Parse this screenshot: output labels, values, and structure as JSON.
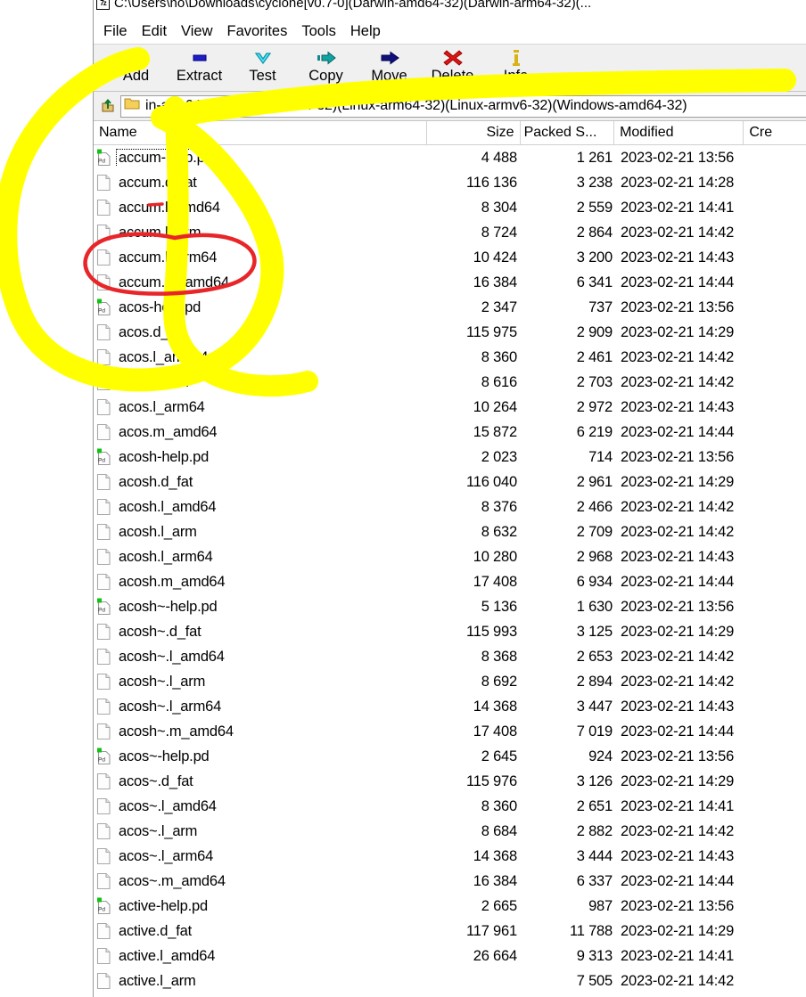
{
  "window": {
    "title": "C:\\Users\\ho\\Downloads\\cyclone[v0.7-0](Darwin-amd64-32)(Darwin-arm64-32)(...",
    "app_glyph": "7z"
  },
  "menubar": {
    "items": [
      {
        "label": "File"
      },
      {
        "label": "Edit"
      },
      {
        "label": "View"
      },
      {
        "label": "Favorites"
      },
      {
        "label": "Tools"
      },
      {
        "label": "Help"
      }
    ]
  },
  "toolbar": {
    "buttons": [
      {
        "label": "Add",
        "icon": "plus-icon",
        "color": "#00d000"
      },
      {
        "label": "Extract",
        "icon": "minus-bar-icon",
        "color": "#0000c0"
      },
      {
        "label": "Test",
        "icon": "chevron-down-icon",
        "color": "#00c8d8"
      },
      {
        "label": "Copy",
        "icon": "arrow-right-teal-icon",
        "color": "#008c8c"
      },
      {
        "label": "Move",
        "icon": "arrow-right-navy-icon",
        "color": "#000080"
      },
      {
        "label": "Delete",
        "icon": "cross-icon",
        "color": "#e00000"
      },
      {
        "label": "Info",
        "icon": "info-icon",
        "color": "#c8a000"
      }
    ]
  },
  "addressbar": {
    "up_icon": "up-folder-icon",
    "folder_icon": "folder-icon",
    "path": "in-arm64-32)(Linux-amd64-32)(Linux-arm64-32)(Linux-armv6-32)(Windows-amd64-32)"
  },
  "columns": [
    {
      "key": "name",
      "label": "Name"
    },
    {
      "key": "size",
      "label": "Size"
    },
    {
      "key": "packed",
      "label": "Packed S..."
    },
    {
      "key": "mod",
      "label": "Modified"
    },
    {
      "key": "crea",
      "label": "Cre"
    }
  ],
  "annotations": {
    "highlighter_color": "#ffff00",
    "circle_color": "#e8262a",
    "underline_color": "#e8262a",
    "circled_rows": [
      "accum.l_arm",
      "accum.l_arm64"
    ]
  },
  "files": [
    {
      "name": "accum-help.pd",
      "icon": "pd-doc-icon",
      "size": "4 488",
      "packed": "1 261",
      "modified": "2023-02-21 13:56",
      "focused": true
    },
    {
      "name": "accum.d_fat",
      "icon": "blank-doc-icon",
      "size": "116 136",
      "packed": "3 238",
      "modified": "2023-02-21 14:28"
    },
    {
      "name": "accum.l_amd64",
      "icon": "blank-doc-icon",
      "size": "8 304",
      "packed": "2 559",
      "modified": "2023-02-21 14:41"
    },
    {
      "name": "accum.l_arm",
      "icon": "blank-doc-icon",
      "size": "8 724",
      "packed": "2 864",
      "modified": "2023-02-21 14:42"
    },
    {
      "name": "accum.l_arm64",
      "icon": "blank-doc-icon",
      "size": "10 424",
      "packed": "3 200",
      "modified": "2023-02-21 14:43"
    },
    {
      "name": "accum.m_amd64",
      "icon": "blank-doc-icon",
      "size": "16 384",
      "packed": "6 341",
      "modified": "2023-02-21 14:44"
    },
    {
      "name": "acos-help.pd",
      "icon": "pd-doc-icon",
      "size": "2 347",
      "packed": "737",
      "modified": "2023-02-21 13:56"
    },
    {
      "name": "acos.d_fat",
      "icon": "blank-doc-icon",
      "size": "115 975",
      "packed": "2 909",
      "modified": "2023-02-21 14:29"
    },
    {
      "name": "acos.l_amd64",
      "icon": "blank-doc-icon",
      "size": "8 360",
      "packed": "2 461",
      "modified": "2023-02-21 14:42"
    },
    {
      "name": "acos.l_arm",
      "icon": "blank-doc-icon",
      "size": "8 616",
      "packed": "2 703",
      "modified": "2023-02-21 14:42"
    },
    {
      "name": "acos.l_arm64",
      "icon": "blank-doc-icon",
      "size": "10 264",
      "packed": "2 972",
      "modified": "2023-02-21 14:43"
    },
    {
      "name": "acos.m_amd64",
      "icon": "blank-doc-icon",
      "size": "15 872",
      "packed": "6 219",
      "modified": "2023-02-21 14:44"
    },
    {
      "name": "acosh-help.pd",
      "icon": "pd-doc-icon",
      "size": "2 023",
      "packed": "714",
      "modified": "2023-02-21 13:56"
    },
    {
      "name": "acosh.d_fat",
      "icon": "blank-doc-icon",
      "size": "116 040",
      "packed": "2 961",
      "modified": "2023-02-21 14:29"
    },
    {
      "name": "acosh.l_amd64",
      "icon": "blank-doc-icon",
      "size": "8 376",
      "packed": "2 466",
      "modified": "2023-02-21 14:42"
    },
    {
      "name": "acosh.l_arm",
      "icon": "blank-doc-icon",
      "size": "8 632",
      "packed": "2 709",
      "modified": "2023-02-21 14:42"
    },
    {
      "name": "acosh.l_arm64",
      "icon": "blank-doc-icon",
      "size": "10 280",
      "packed": "2 968",
      "modified": "2023-02-21 14:43"
    },
    {
      "name": "acosh.m_amd64",
      "icon": "blank-doc-icon",
      "size": "17 408",
      "packed": "6 934",
      "modified": "2023-02-21 14:44"
    },
    {
      "name": "acosh~-help.pd",
      "icon": "pd-doc-icon",
      "size": "5 136",
      "packed": "1 630",
      "modified": "2023-02-21 13:56"
    },
    {
      "name": "acosh~.d_fat",
      "icon": "blank-doc-icon",
      "size": "115 993",
      "packed": "3 125",
      "modified": "2023-02-21 14:29"
    },
    {
      "name": "acosh~.l_amd64",
      "icon": "blank-doc-icon",
      "size": "8 368",
      "packed": "2 653",
      "modified": "2023-02-21 14:42"
    },
    {
      "name": "acosh~.l_arm",
      "icon": "blank-doc-icon",
      "size": "8 692",
      "packed": "2 894",
      "modified": "2023-02-21 14:42"
    },
    {
      "name": "acosh~.l_arm64",
      "icon": "blank-doc-icon",
      "size": "14 368",
      "packed": "3 447",
      "modified": "2023-02-21 14:43"
    },
    {
      "name": "acosh~.m_amd64",
      "icon": "blank-doc-icon",
      "size": "17 408",
      "packed": "7 019",
      "modified": "2023-02-21 14:44"
    },
    {
      "name": "acos~-help.pd",
      "icon": "pd-doc-icon",
      "size": "2 645",
      "packed": "924",
      "modified": "2023-02-21 13:56"
    },
    {
      "name": "acos~.d_fat",
      "icon": "blank-doc-icon",
      "size": "115 976",
      "packed": "3 126",
      "modified": "2023-02-21 14:29"
    },
    {
      "name": "acos~.l_amd64",
      "icon": "blank-doc-icon",
      "size": "8 360",
      "packed": "2 651",
      "modified": "2023-02-21 14:41"
    },
    {
      "name": "acos~.l_arm",
      "icon": "blank-doc-icon",
      "size": "8 684",
      "packed": "2 882",
      "modified": "2023-02-21 14:42"
    },
    {
      "name": "acos~.l_arm64",
      "icon": "blank-doc-icon",
      "size": "14 368",
      "packed": "3 444",
      "modified": "2023-02-21 14:43"
    },
    {
      "name": "acos~.m_amd64",
      "icon": "blank-doc-icon",
      "size": "16 384",
      "packed": "6 337",
      "modified": "2023-02-21 14:44"
    },
    {
      "name": "active-help.pd",
      "icon": "pd-doc-icon",
      "size": "2 665",
      "packed": "987",
      "modified": "2023-02-21 13:56"
    },
    {
      "name": "active.d_fat",
      "icon": "blank-doc-icon",
      "size": "117 961",
      "packed": "11 788",
      "modified": "2023-02-21 14:29"
    },
    {
      "name": "active.l_amd64",
      "icon": "blank-doc-icon",
      "size": "26 664",
      "packed": "9 313",
      "modified": "2023-02-21 14:41"
    },
    {
      "name": "active.l_arm",
      "icon": "blank-doc-icon",
      "size": "",
      "packed": "7 505",
      "modified": "2023-02-21 14:42"
    }
  ]
}
